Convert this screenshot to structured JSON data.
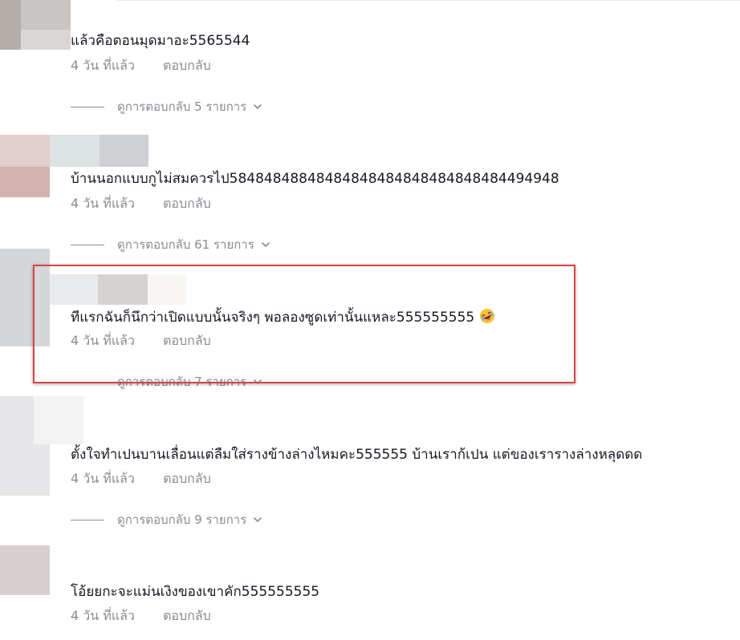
{
  "comments": [
    {
      "text": "แล้วคือตอนมุดมาอะ5565544",
      "time": "4 วัน ที่แล้ว",
      "reply_label": "ตอบกลับ",
      "view_replies": "ดูการตอบกลับ 5 รายการ"
    },
    {
      "text": "บ้านนอกแบบกูไม่สมควรไป58484848848484848484848484848484494948",
      "time": "4 วัน ที่แล้ว",
      "reply_label": "ตอบกลับ",
      "view_replies": "ดูการตอบกลับ 61 รายการ"
    },
    {
      "text": "ทีแรกฉันก็นึกว่าเปิดแบบนั้นจริงๆ พอลองซูดเท่านั้นแหละ555555555",
      "emoji": "rolling-laughing-emoji",
      "time": "4 วัน ที่แล้ว",
      "reply_label": "ตอบกลับ",
      "view_replies": "ดูการตอบกลับ 7 รายการ"
    },
    {
      "text": "ตั้งใจทำเปนบานเลื่อนแต่ลืมใส่รางข้างล่างไหมคะ555555 บ้านเราก้เปน แต่ของเรารางล่างหลุดดด",
      "time": "4 วัน ที่แล้ว",
      "reply_label": "ตอบกลับ",
      "view_replies": "ดูการตอบกลับ 9 รายการ"
    },
    {
      "text": "โอ้ยยกะจะแม่นเงิงของเขาคัก555555555",
      "time": "4 วัน ที่แล้ว",
      "reply_label": "ตอบกลับ"
    }
  ],
  "colors": {
    "text": "#161823",
    "meta": "#8a8b91",
    "highlight": "#dc4446"
  }
}
